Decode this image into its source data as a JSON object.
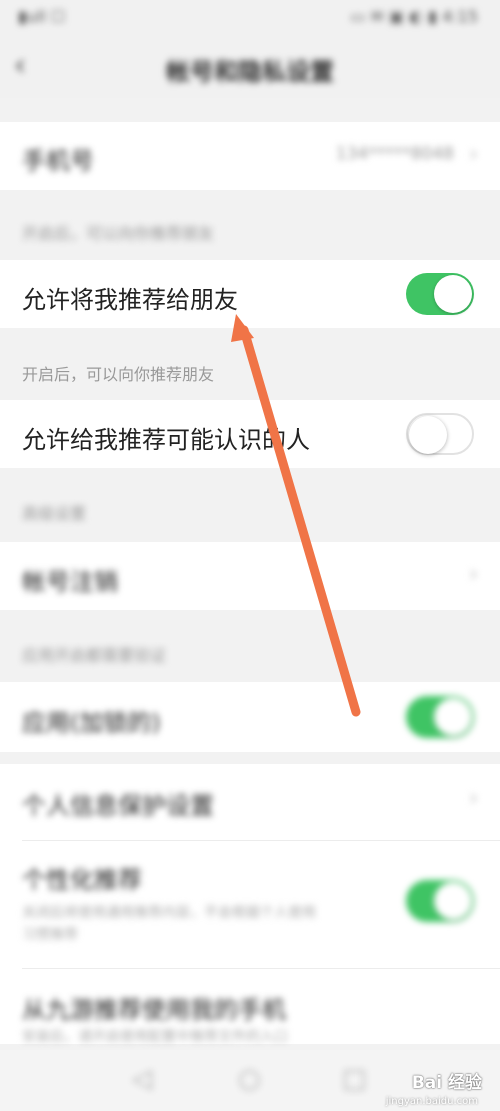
{
  "status_bar": {
    "left": "▮ull ☐",
    "right": "▭ ✉ ▣ ◐ ▮ 4:15"
  },
  "nav": {
    "back": "‹",
    "title": "帐号和隐私设置"
  },
  "rows": {
    "phone": {
      "label": "手机号",
      "value": "134*****8048",
      "chevron": "›"
    },
    "hint_1": "开启后，可以向你推荐朋友",
    "recommend_to_friends": {
      "label": "允许将我推荐给朋友",
      "toggle": "on"
    },
    "hint_2": "开启后，可以向你推荐朋友",
    "recommend_maybe_known": {
      "label": "允许给我推荐可能认识的人",
      "toggle": "off"
    },
    "section_advanced": "高级设置",
    "account_cancel": {
      "label": "帐号注销",
      "chevron": "›"
    },
    "section_lock": "应用开启都需要验证",
    "lock": {
      "label": "应用(加锁的)",
      "toggle": "on"
    },
    "personal_info": {
      "label": "个人信息保护设置",
      "chevron": "›"
    },
    "personalized": {
      "label": "个性化推荐",
      "desc_1": "关闭后将使用通用推荐内容，不会根据个人使用",
      "desc_2": "习惯推荐",
      "toggle": "on"
    },
    "third_party": {
      "label": "从九游推荐使用我的手机",
      "desc": "安装后，请开启使用配置中推荐文件的入口"
    }
  },
  "bottom_nav": {
    "back": "◁",
    "home": "○",
    "recent": "□"
  },
  "watermark": {
    "text": "Bai 经验",
    "url": "jingyan.baidu.com"
  },
  "colors": {
    "toggle_on": "#3fc464",
    "arrow": "#f07447",
    "page_bg": "#f2f2f2"
  }
}
